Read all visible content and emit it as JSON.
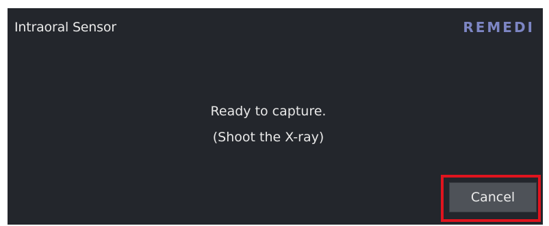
{
  "dialog": {
    "title": "Intraoral Sensor",
    "brand_logo": "REMEDI",
    "message_line1": "Ready to capture.",
    "message_line2": "(Shoot the X-ray)",
    "cancel_label": "Cancel"
  },
  "colors": {
    "background": "#23262c",
    "logo": "#7d86c4",
    "highlight": "#e0141e",
    "button": "#4e5258"
  }
}
